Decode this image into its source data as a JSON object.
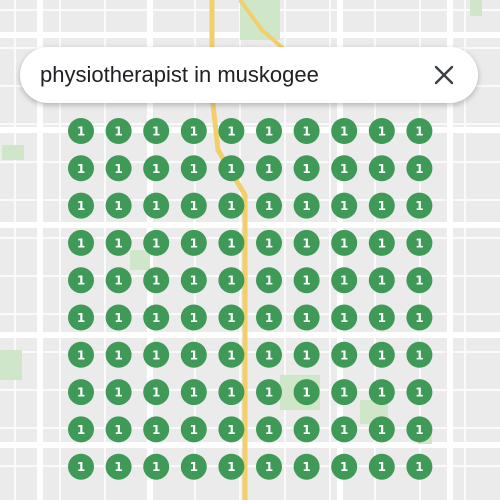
{
  "search": {
    "query": "physiotherapist in muskogee",
    "close_icon": "close-icon"
  },
  "grid": {
    "rows": 10,
    "cols": 10,
    "rank_label": "1",
    "marker_color": "#3f9a57",
    "marker_text_color": "#ffffff"
  },
  "map": {
    "background_color": "#ebebeb",
    "road_color": "#ffffff",
    "highway_color": "#f2cf6b",
    "park_color": "#cfe6c9"
  }
}
